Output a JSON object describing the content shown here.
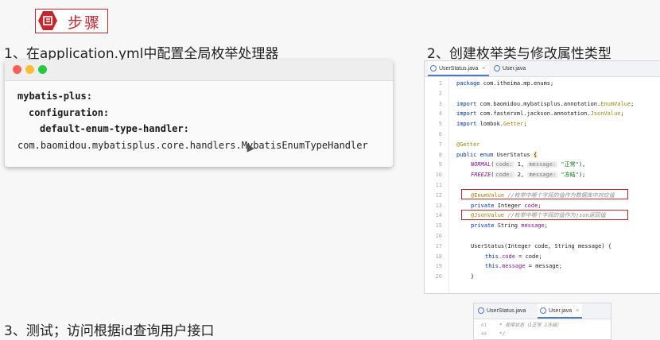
{
  "step_title": "步骤",
  "section1": {
    "heading": "1、在application.yml中配置全局枚举处理器"
  },
  "section2": {
    "heading": "2、创建枚举类与修改属性类型"
  },
  "section3": {
    "heading": "3、测试；访问根据id查询用户接口"
  },
  "yaml": {
    "line1": "mybatis-plus:",
    "line2": "configuration:",
    "line3": "default-enum-type-handler:",
    "line4": "com.baomidou.mybatisplus.core.handlers.MybatisEnumTypeHandler"
  },
  "ide": {
    "tabs": [
      "UserStatus.java",
      "User.java"
    ],
    "tab_close": "×",
    "lines": [
      {
        "n": "1"
      },
      {
        "n": "2"
      },
      {
        "n": "3"
      },
      {
        "n": "4"
      },
      {
        "n": "5"
      },
      {
        "n": "6"
      },
      {
        "n": "7"
      },
      {
        "n": "8"
      },
      {
        "n": "9"
      },
      {
        "n": "10"
      },
      {
        "n": "11"
      },
      {
        "n": "12"
      },
      {
        "n": "13"
      },
      {
        "n": "14"
      },
      {
        "n": "15"
      },
      {
        "n": "16"
      },
      {
        "n": "17"
      },
      {
        "n": "18"
      },
      {
        "n": "19"
      },
      {
        "n": "20"
      }
    ],
    "code": {
      "l1_kw": "package",
      "l1_rest": " com.itheima.mp.enums;",
      "l3_kw": "import",
      "l3_a": " com.baomidou.mybatisplus.annotation.",
      "l3_b": "EnumValue",
      "l3_c": ";",
      "l4_kw": "import",
      "l4_a": " com.fasterxml.jackson.annotation.",
      "l4_b": "JsonValue",
      "l4_c": ";",
      "l5_kw": "import",
      "l5_a": " lombok.",
      "l5_b": "Getter",
      "l5_c": ";",
      "l7": "@Getter",
      "l8_kw": "public enum",
      "l8_rest": " UserStatus ",
      "l8_brace": "{",
      "l9_name": "NORMAL",
      "l9_h1": "code:",
      "l9_v1": " 1, ",
      "l9_h2": "message:",
      "l9_str": "\"正常\"",
      "l9_end": "),",
      "l10_name": "FREEZE",
      "l10_h1": "code:",
      "l10_v1": " 2, ",
      "l10_h2": "message:",
      "l10_str": "\"冻结\"",
      "l10_end": ");",
      "l12_ann": "@EnumValue",
      "l12_cmt": " //枚举中哪个字段的值作为数据库中对应值",
      "l13_kw": "private",
      "l13_rest": " Integer ",
      "l13_fld": "code",
      "l13_end": ";",
      "l14_ann": "@JsonValue",
      "l14_cmt": " //枚举中哪个字段的值作为json返回值",
      "l15_kw": "private",
      "l15_rest": " String ",
      "l15_fld": "message",
      "l15_end": ";",
      "l17": "UserStatus(Integer code, String message) {",
      "l18_kw": "this",
      "l18_a": ".",
      "l18_fld": "code",
      "l18_b": " = code;",
      "l19_kw": "this",
      "l19_a": ".",
      "l19_fld": "message",
      "l19_b": " = message;",
      "l20": "}"
    }
  },
  "ide2": {
    "tabs": [
      "UserStatus.java",
      "User.java"
    ],
    "tab_close": "×",
    "ln1": "41",
    "ln2": "44",
    "line1": "* 使用状态（1正常 2冻结）",
    "line2": "*/"
  },
  "colors": {
    "accent": "#c4282f",
    "dot_red": "#ff5f57",
    "dot_yellow": "#febc2e",
    "dot_green": "#28c840"
  }
}
